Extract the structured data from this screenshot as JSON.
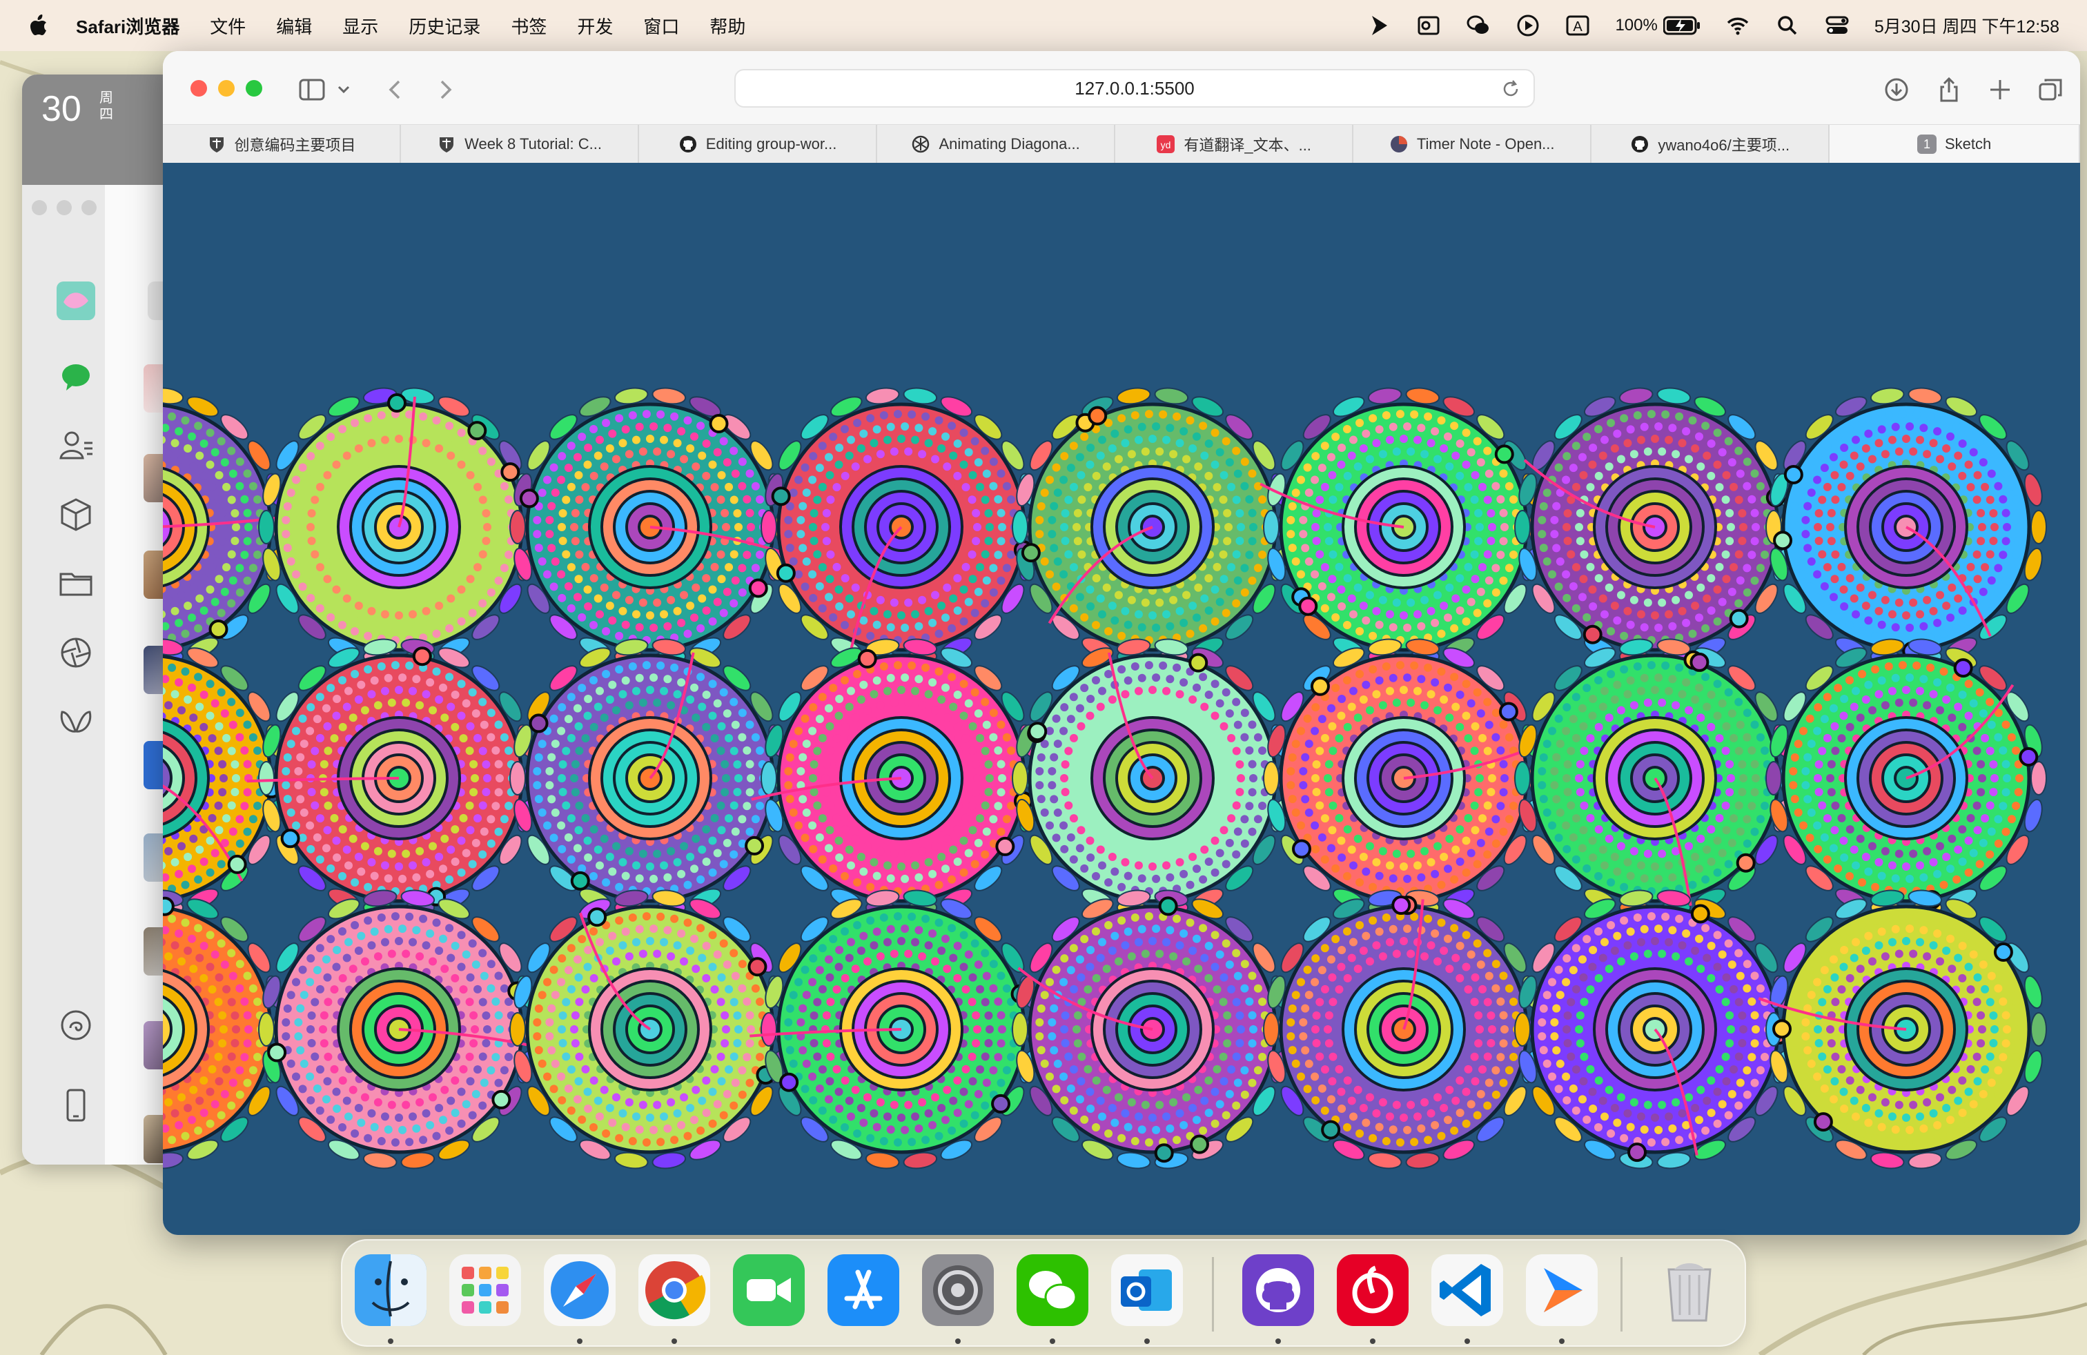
{
  "menubar": {
    "app_name": "Safari浏览器",
    "menus": [
      "文件",
      "编辑",
      "显示",
      "历史记录",
      "书签",
      "开发",
      "窗口",
      "帮助"
    ],
    "battery_percent": "100%",
    "input_method": "A",
    "datetime": "5月30日 周四 下午12:58"
  },
  "wechat_window": {
    "date_day": "30",
    "date_week": "周四"
  },
  "safari": {
    "url": "127.0.0.1:5500",
    "tabs": [
      {
        "title": "创意编码主要项目",
        "favicon": "crest-icon"
      },
      {
        "title": "Week 8 Tutorial: C...",
        "favicon": "crest-icon"
      },
      {
        "title": "Editing group-wor...",
        "favicon": "github-icon"
      },
      {
        "title": "Animating Diagona...",
        "favicon": "openai-icon"
      },
      {
        "title": "有道翻译_文本、...",
        "favicon": "youdao-icon"
      },
      {
        "title": "Timer Note - Open...",
        "favicon": "timer-icon"
      },
      {
        "title": "ywano4o6/主要项...",
        "favicon": "github-icon"
      },
      {
        "title": "Sketch",
        "favicon": "badge-icon",
        "badge": "1",
        "active": true
      }
    ],
    "canvas_background": "#24547b"
  },
  "dock": {
    "apps": [
      "Finder",
      "Launchpad",
      "Safari",
      "Chrome",
      "FaceTime",
      "App Store",
      "System Settings",
      "WeChat",
      "Outlook",
      "GitHub Desktop",
      "NetEase Music",
      "VS Code",
      "Sketch App",
      "Trash"
    ]
  }
}
